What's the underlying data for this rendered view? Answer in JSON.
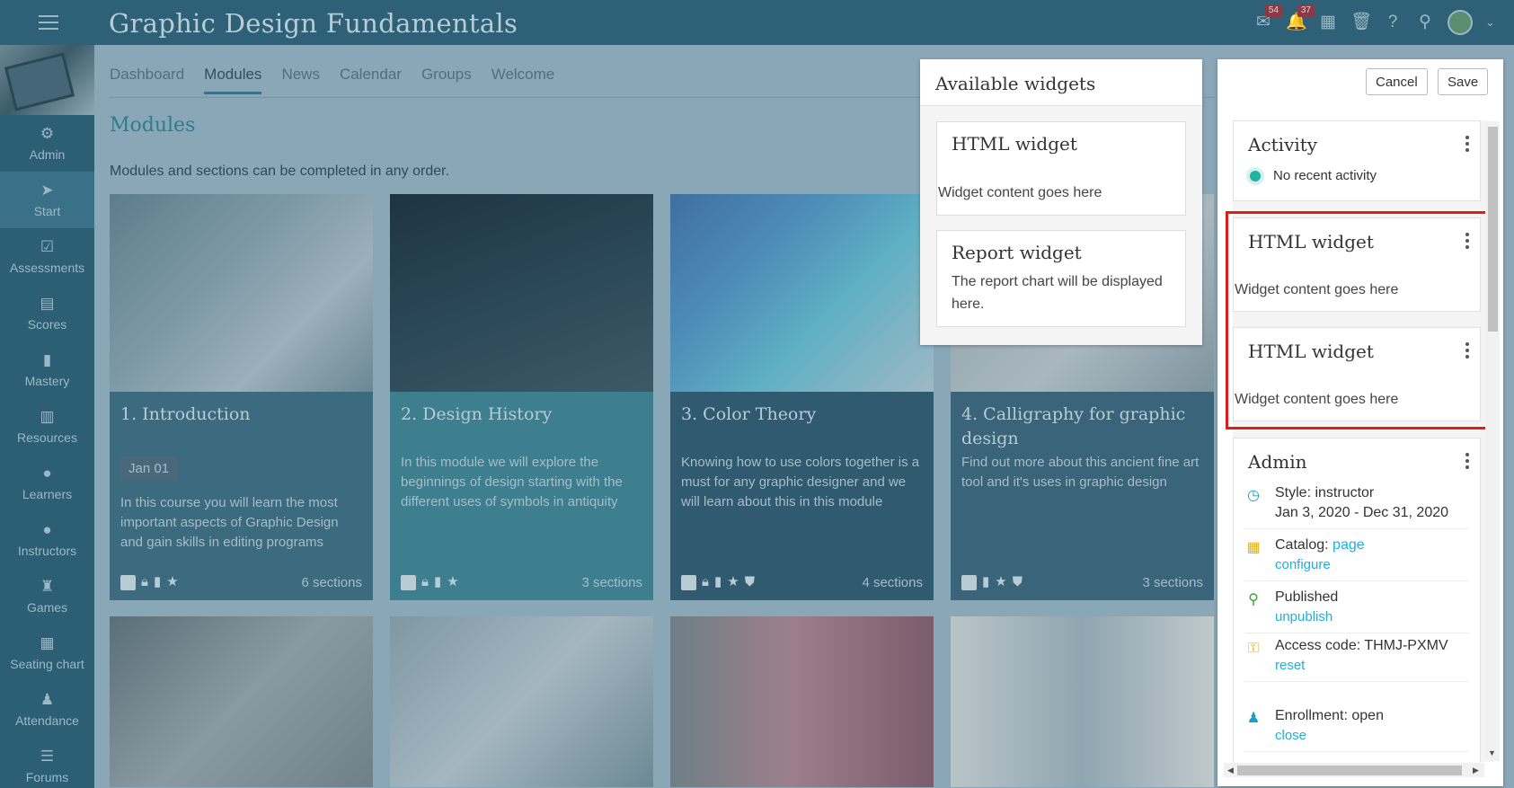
{
  "app": {
    "title": "Graphic Design Fundamentals"
  },
  "header": {
    "messages_badge": "54",
    "notifications_badge": "37",
    "icons": [
      "messages-icon",
      "notifications-icon",
      "calendar-icon",
      "trash-icon",
      "help-icon",
      "search-icon",
      "avatar",
      "chevron-down-icon"
    ]
  },
  "sidebar": {
    "items": [
      {
        "label": "Admin",
        "icon": "gear-icon"
      },
      {
        "label": "Start",
        "icon": "navigation-arrow-icon"
      },
      {
        "label": "Assessments",
        "icon": "checkbox-icon"
      },
      {
        "label": "Scores",
        "icon": "gradebook-icon"
      },
      {
        "label": "Mastery",
        "icon": "bar-chart-icon"
      },
      {
        "label": "Resources",
        "icon": "library-icon"
      },
      {
        "label": "Learners",
        "icon": "person-icon"
      },
      {
        "label": "Instructors",
        "icon": "instructor-icon"
      },
      {
        "label": "Games",
        "icon": "trophy-icon"
      },
      {
        "label": "Seating chart",
        "icon": "seating-icon"
      },
      {
        "label": "Attendance",
        "icon": "group-icon"
      },
      {
        "label": "Forums",
        "icon": "list-icon"
      }
    ]
  },
  "tabs": [
    "Dashboard",
    "Modules",
    "News",
    "Calendar",
    "Groups",
    "Welcome"
  ],
  "main": {
    "title": "Modules",
    "description": "Modules and sections can be completed in any order.",
    "modules": [
      {
        "title": "1. Introduction",
        "date": "Jan 01",
        "text": "In this course you will learn the most important aspects of Graphic Design and gain skills in editing programs",
        "sections": "6 sections"
      },
      {
        "title": "2. Design History",
        "date": "",
        "text": "In this module we will explore the beginnings of design starting with the different uses of symbols in antiquity",
        "sections": "3 sections"
      },
      {
        "title": "3. Color Theory",
        "date": "",
        "text": "Knowing how to use colors together is a must for any graphic designer and we will learn about this in this module",
        "sections": "4 sections"
      },
      {
        "title": "4. Calligraphy for graphic design",
        "date": "",
        "text": "Find out more about this ancient fine art tool and it's uses in graphic design",
        "sections": "3 sections"
      }
    ]
  },
  "available_widgets": {
    "title": "Available widgets",
    "widgets": [
      {
        "title": "HTML widget",
        "text": "Widget content goes here"
      },
      {
        "title": "Report widget",
        "text": "The report chart will be displayed here."
      }
    ]
  },
  "editor": {
    "cancel_label": "Cancel",
    "save_label": "Save",
    "activity": {
      "title": "Activity",
      "status": "No recent activity"
    },
    "html_widgets": [
      {
        "title": "HTML widget",
        "text": "Widget content goes here"
      },
      {
        "title": "HTML widget",
        "text": "Widget content goes here"
      }
    ],
    "admin": {
      "title": "Admin",
      "style": "Style: instructor",
      "dates": "Jan 3, 2020 - Dec 31, 2020",
      "catalog_label": "Catalog:",
      "catalog_link": "page",
      "catalog_configure": "configure",
      "published": "Published",
      "unpublish": "unpublish",
      "access_code": "Access code: THMJ-PXMV",
      "reset": "reset",
      "enrollment": "Enrollment: open",
      "close": "close"
    }
  },
  "colors": {
    "highlight": "#e01b1b",
    "accent": "#1fb0d8",
    "topbar": "#2e6177"
  }
}
